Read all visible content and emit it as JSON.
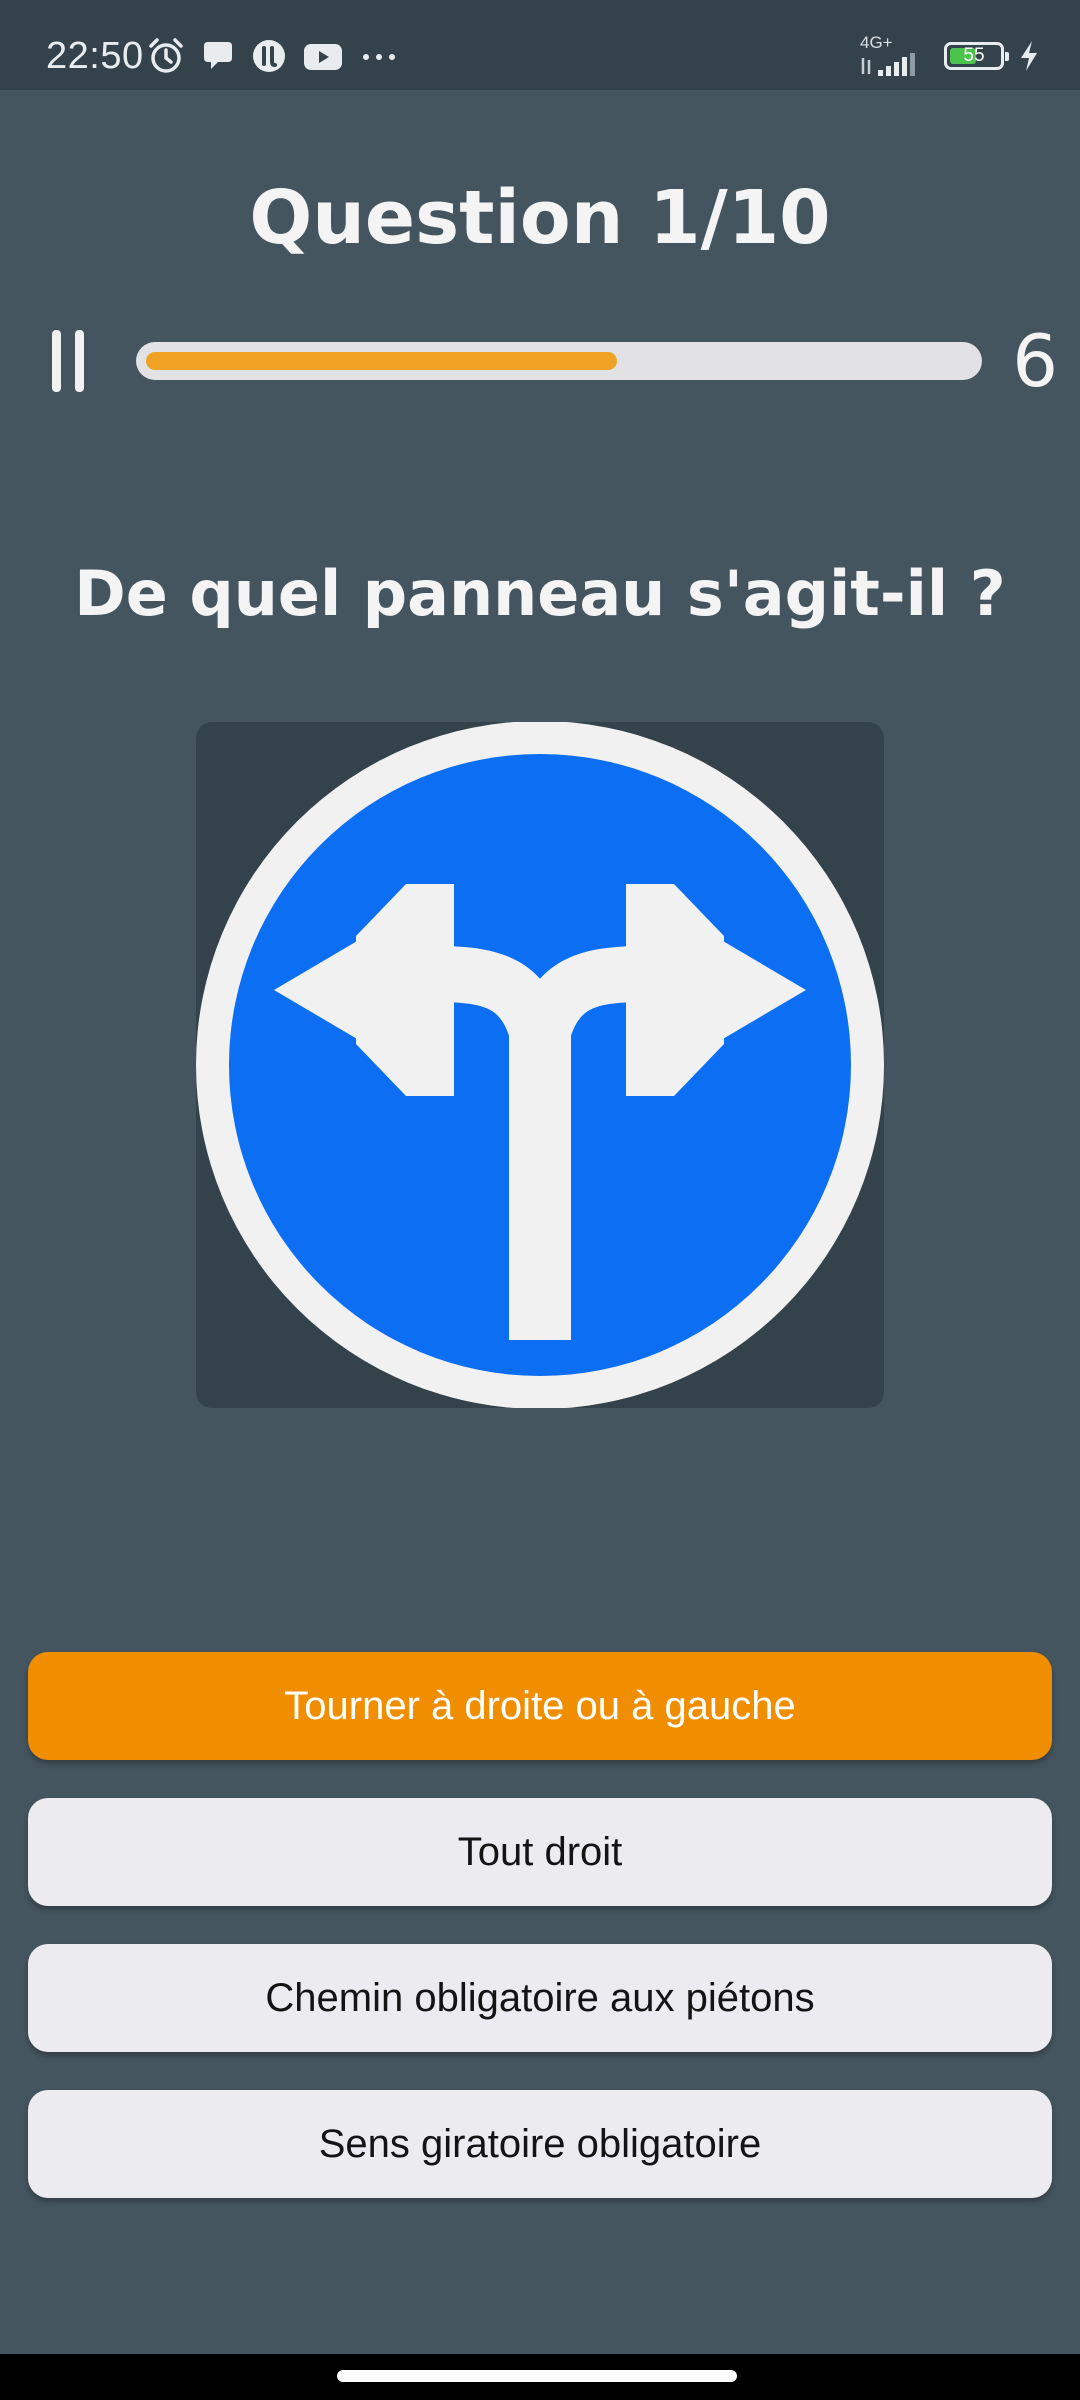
{
  "status_bar": {
    "time": "22:50",
    "left_icons": [
      "alarm-icon",
      "chat-bubble-icon",
      "tiktok-icon",
      "youtube-icon",
      "more-dots-icon"
    ],
    "more_label": "···",
    "network_label": "4G+",
    "battery_level": "55",
    "battery_fraction": 0.55,
    "charging": true
  },
  "quiz": {
    "question_counter": "Question 1/10",
    "progress_fraction": 0.57,
    "timer": "6",
    "question": "De quel panneau s'agit-il ?",
    "sign_icon": "road-sign-turn-left-or-right-icon",
    "answers": [
      {
        "label": "Tourner à droite ou à gauche",
        "selected": true
      },
      {
        "label": "Tout droit",
        "selected": false
      },
      {
        "label": "Chemin obligatoire aux piétons",
        "selected": false
      },
      {
        "label": "Sens giratoire obligatoire",
        "selected": false
      }
    ]
  },
  "colors": {
    "background": "#455560",
    "status_bar": "#34424c",
    "progress_fill": "#f0a225",
    "answer_selected": "#f08e00",
    "answer_default": "#ececf0",
    "sign_blue": "#0c6ef3",
    "sign_white": "#f1f1f1"
  }
}
